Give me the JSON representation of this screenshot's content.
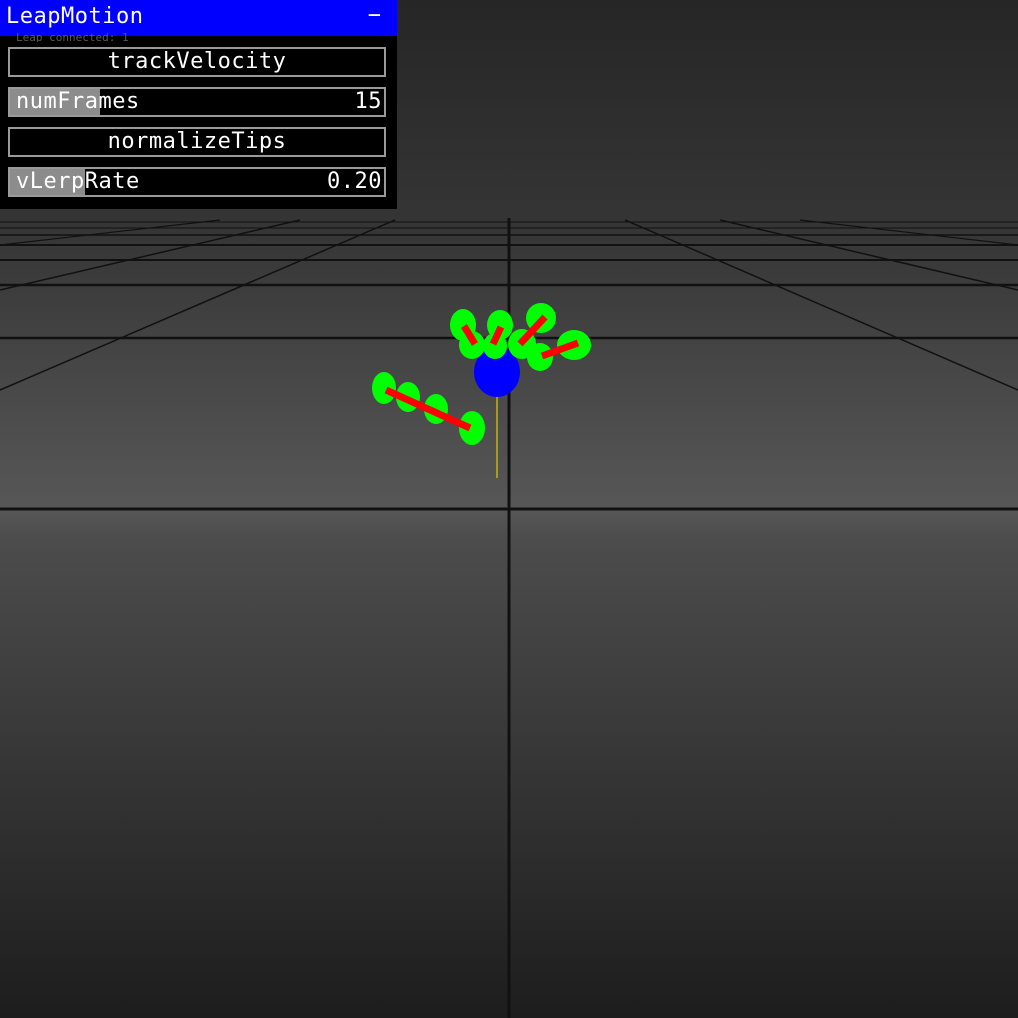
{
  "panel": {
    "title": "LeapMotion",
    "minimize_label": "−",
    "status_text": "Leap connected: 1",
    "header_color": "#0000ff",
    "controls": {
      "track_velocity": {
        "label": "trackVelocity"
      },
      "num_frames": {
        "label": "numFrames",
        "value": "15",
        "fill_fraction": 0.24
      },
      "normalize_tips": {
        "label": "normalizeTips"
      },
      "v_lerp_rate": {
        "label": "vLerpRate",
        "value": "0.20",
        "fill_fraction": 0.2
      }
    }
  },
  "scene": {
    "grid_color": "#111111",
    "palm_color": "#0000ff",
    "finger_joint_color": "#00ff00",
    "finger_bone_color": "#ff0000",
    "velocity_line_color": "#c8b400"
  }
}
